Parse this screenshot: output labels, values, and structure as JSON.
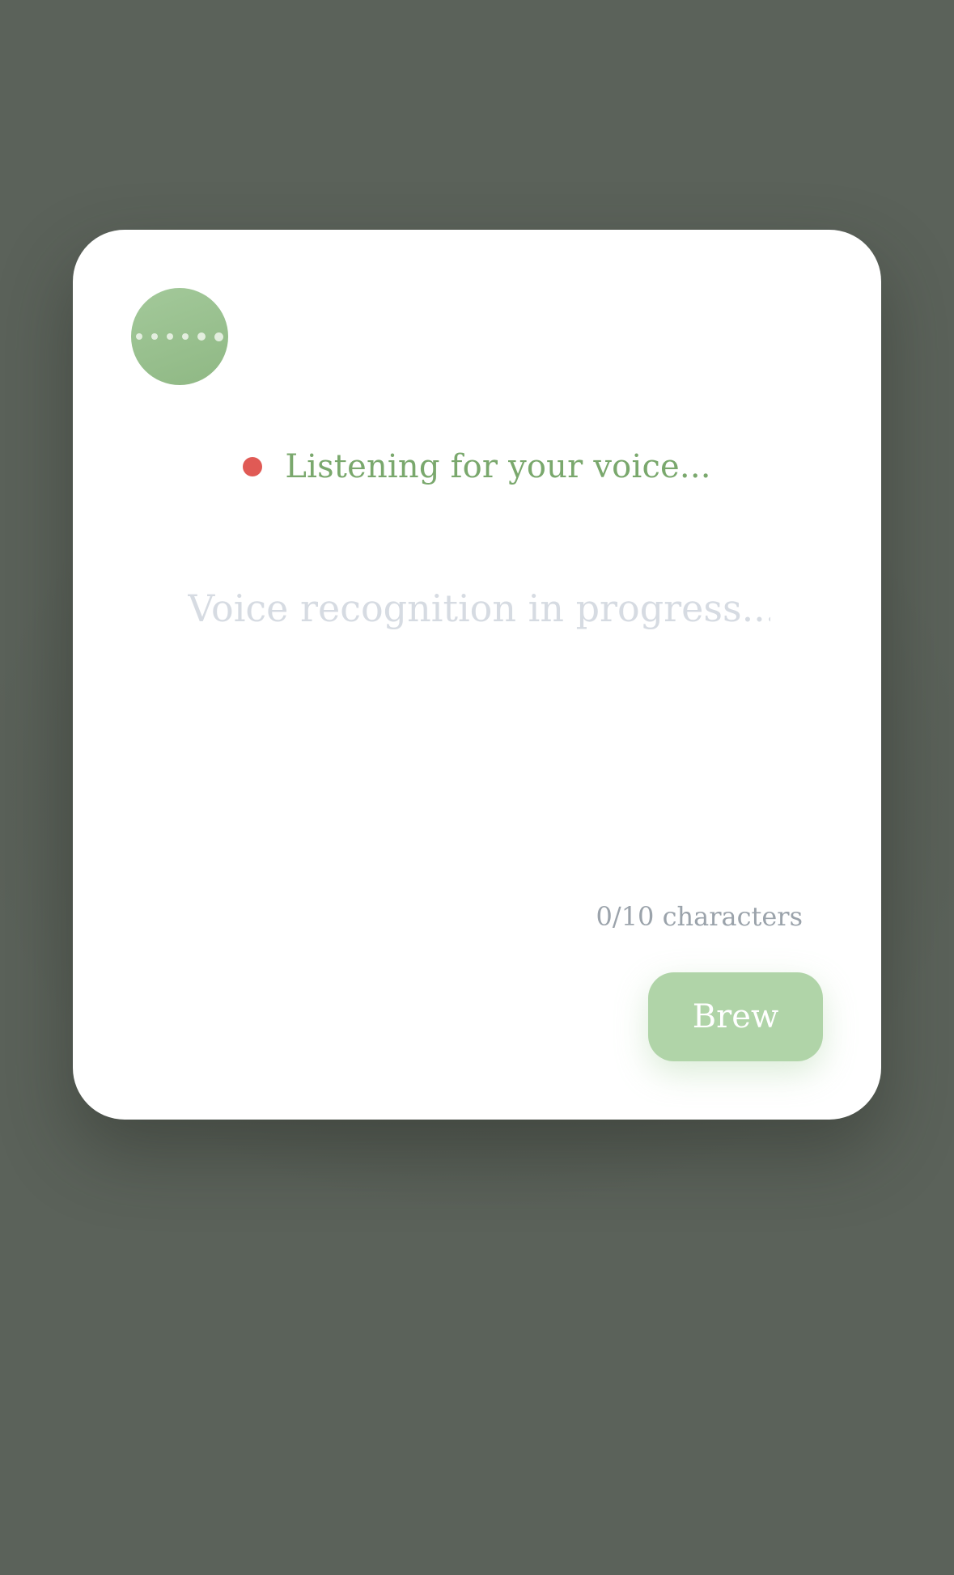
{
  "app": {
    "background_color": "#5b625a",
    "accent_color": "#8fb884"
  },
  "voice_orb": {
    "icon": "waveform-dots-icon",
    "dot_count": 6
  },
  "status": {
    "indicator": "recording-dot",
    "indicator_color": "#e05a55",
    "text": "Listening for your voice..."
  },
  "transcript": {
    "value": "",
    "placeholder": "Voice recognition in progress..."
  },
  "char_count": {
    "text": "0/10 characters",
    "current": 0,
    "max": 10
  },
  "actions": {
    "brew_label": "Brew",
    "brew_color": "#b0d4a8"
  }
}
